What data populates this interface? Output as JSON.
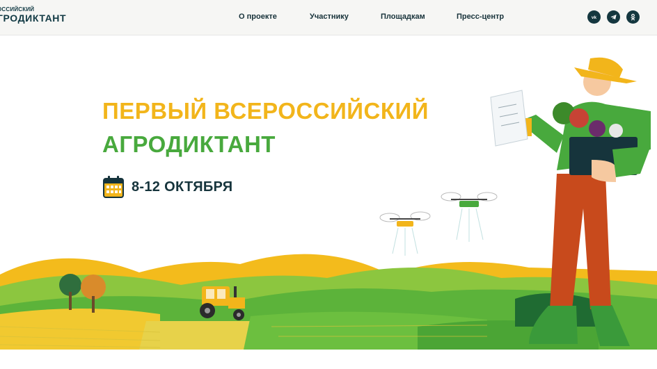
{
  "header": {
    "logo_small": "ОССИЙСКИЙ",
    "logo_big": "ГРОДИКТАНТ",
    "nav": [
      {
        "label": "О проекте"
      },
      {
        "label": "Участнику"
      },
      {
        "label": "Площадкам"
      },
      {
        "label": "Пресс-центр"
      }
    ],
    "social": [
      {
        "icon": "vk-icon"
      },
      {
        "icon": "telegram-icon"
      },
      {
        "icon": "odnoklassniki-icon"
      }
    ]
  },
  "hero": {
    "title_line1": "ПЕРВЫЙ ВСЕРОССИЙСКИЙ",
    "title_line2": "АГРОДИКТАНТ",
    "dates": "8-12 ОКТЯБРЯ",
    "date_icon": "calendar-icon"
  },
  "colors": {
    "yellow": "#f2b51b",
    "green": "#48a93d",
    "dark": "#16343c",
    "orange_pants": "#c84a1c"
  }
}
